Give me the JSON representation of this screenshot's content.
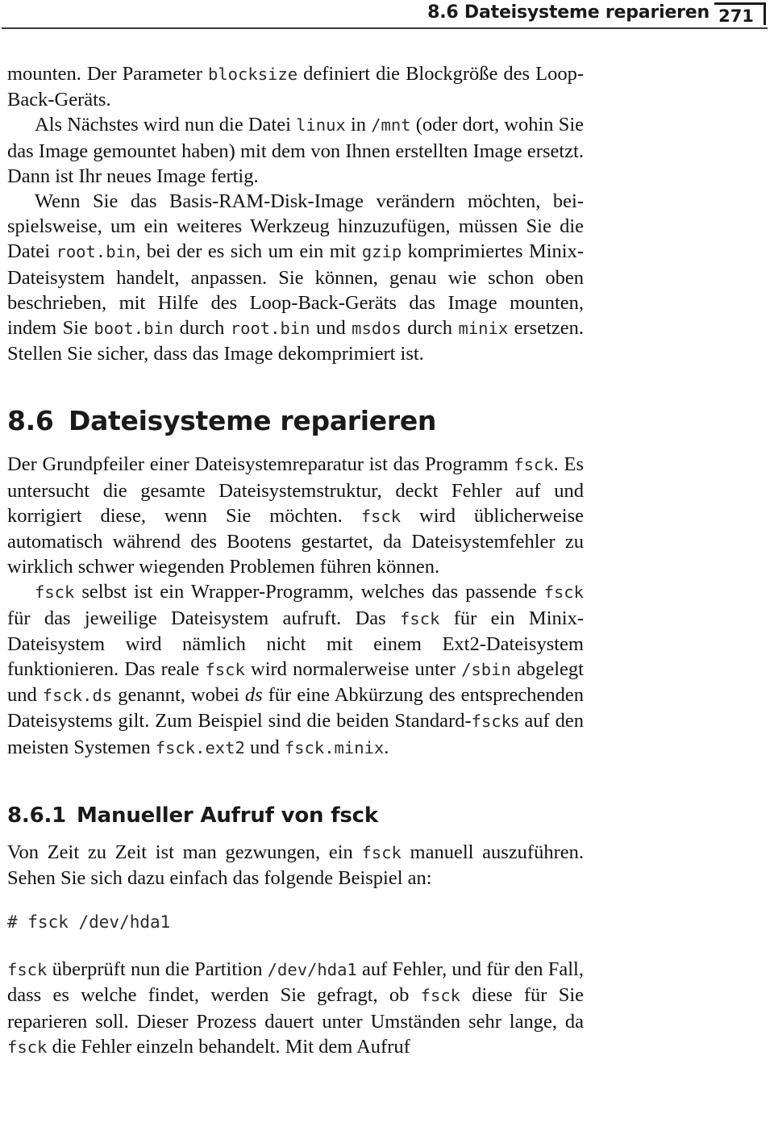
{
  "header": {
    "title": "8.6 Dateisysteme reparieren",
    "page_number": "271"
  },
  "body": {
    "para1": {
      "seg1": "mounten. Der Parameter ",
      "code1": "blocksize",
      "seg2": " definiert die Blockgröße des Loop-Back-Geräts."
    },
    "para2": {
      "seg1": "Als Nächstes wird nun die Datei ",
      "code1": "linux",
      "seg2": " in ",
      "code2": "/mnt",
      "seg3": " (oder dort, wo­hin Sie das Image gemountet haben) mit dem von Ihnen erstellten Image ersetzt. Dann ist Ihr neues Image fertig."
    },
    "para3": {
      "seg1": "Wenn Sie das Basis-RAM-Disk-Image verändern möchten, bei­spielsweise, um ein weiteres Werkzeug hinzuzufügen, müssen Sie die Datei ",
      "code1": "root.bin",
      "seg2": ", bei der es sich um ein mit ",
      "code2": "gzip",
      "seg3": " kompri­miertes Minix-Dateisystem handelt, anpassen. Sie können, genau wie schon oben beschrieben, mit Hilfe des Loop-Back-Geräts das Image mounten, indem Sie ",
      "code3": "boot.bin",
      "seg4": " durch ",
      "code4": "root.bin",
      "seg5": " und ",
      "code5": "msdos",
      "seg6": " durch ",
      "code6": "minix",
      "seg7": " ersetzen. Stellen Sie sicher, dass das Image dekom­primiert ist."
    }
  },
  "section": {
    "number": "8.6",
    "title": "Dateisysteme reparieren",
    "para1": {
      "seg1": "Der Grundpfeiler einer Dateisystemreparatur ist das Programm ",
      "code1": "fsck",
      "seg2": ". Es untersucht die gesamte Dateisystemstruktur, deckt Feh­ler auf und korrigiert diese, wenn Sie möchten. ",
      "code2": "fsck",
      "seg3": " wird übli­cherweise automatisch während des Bootens gestartet, da Datei­systemfehler zu wirklich schwer wiegenden Problemen führen kön­nen."
    },
    "para2": {
      "code1": "fsck",
      "seg1": " selbst ist ein Wrapper-Programm, welches das passen­de ",
      "code2": "fsck",
      "seg2": " für das jeweilige Dateisystem aufruft. Das ",
      "code3": "fsck",
      "seg3": " für ein Minix-Dateisystem wird nämlich nicht mit einem Ext2-Da­teisystem funktionieren. Das reale ",
      "code4": "fsck",
      "seg4": " wird normalerweise un­ter ",
      "code5": "/sbin",
      "seg5": " abgelegt und ",
      "code6": "fsck.ds",
      "seg6": " genannt, wobei ",
      "italic1": "ds",
      "seg7": " für eine Ab­kürzung des entsprechenden Dateisystems gilt. Zum Beispiel sind die beiden Standard-",
      "code7": "fsck",
      "seg8": "s auf den meisten Systemen ",
      "code8": "fsck.ext2",
      "seg9": " und ",
      "code9": "fsck.minix",
      "seg10": "."
    }
  },
  "subsection": {
    "number": "8.6.1",
    "title": "Manueller Aufruf von fsck",
    "para1": {
      "seg1": "Von Zeit zu Zeit ist man gezwungen, ein ",
      "code1": "fsck",
      "seg2": " manuell auszuführ­en. Sehen Sie sich dazu einfach das folgende Beispiel an:"
    },
    "code_block": "# fsck /dev/hda1",
    "para2": {
      "code1": "fsck",
      "seg1": " überprüft nun die Partition ",
      "code2": "/dev/hda1",
      "seg2": " auf Fehler, und für den Fall, dass es welche findet, werden Sie gefragt, ob ",
      "code3": "fsck",
      "seg3": " die­se für Sie reparieren soll. Dieser Prozess dauert unter Umständen sehr lange, da ",
      "code4": "fsck",
      "seg4": " die Fehler einzeln behandelt. Mit dem Aufruf"
    }
  },
  "colors": {
    "text": "#121212",
    "rule": "#3a3a3a",
    "code": "#2b2b2b"
  }
}
